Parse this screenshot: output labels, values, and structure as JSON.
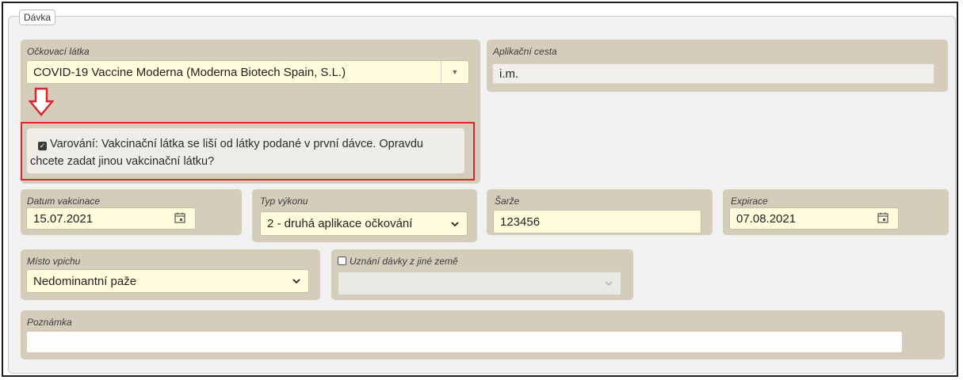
{
  "fieldset": {
    "legend": "Dávka"
  },
  "vaccine": {
    "label": "Očkovací látka",
    "value": "COVID-19 Vaccine Moderna (Moderna Biotech Spain, S.L.)"
  },
  "route": {
    "label": "Aplikační cesta",
    "value": "i.m."
  },
  "warning": {
    "checked": true,
    "text_line1": "Varování: Vakcinační látka se liší od látky podané v první dávce. Opravdu",
    "text_line2": "chcete zadat jinou vakcinační látku?"
  },
  "date": {
    "label": "Datum vakcinace",
    "value": "15.07.2021"
  },
  "procedure_type": {
    "label": "Typ výkonu",
    "value": "2 - druhá aplikace očkování"
  },
  "batch": {
    "label": "Šarže",
    "value": "123456"
  },
  "expiry": {
    "label": "Expirace",
    "value": "07.08.2021"
  },
  "injection_site": {
    "label": "Místo vpichu",
    "value": "Nedominantní paže"
  },
  "foreign_dose": {
    "label": "Uznání dávky z jiné země",
    "checked": false,
    "value": ""
  },
  "note": {
    "label": "Poznámka",
    "value": ""
  },
  "colors": {
    "panel": "#d5cdbc",
    "input_yellow": "#fefcdc",
    "warning_border": "#e0242c",
    "arrow": "#e0242c"
  }
}
